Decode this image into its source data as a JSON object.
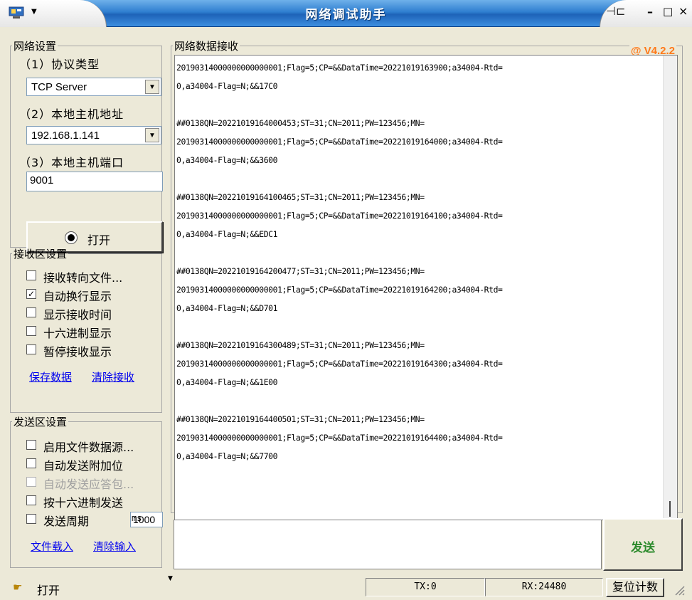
{
  "window": {
    "title": "网络调试助手",
    "version": "@ V4.2.2"
  },
  "network": {
    "group_title": "网络设置",
    "protocol_label": "（1）协议类型",
    "protocol_value": "TCP Server",
    "host_addr_label": "（2）本地主机地址",
    "host_addr_value": "192.168.1.141",
    "host_port_label": "（3）本地主机端口",
    "host_port_value": "9001",
    "open_button_label": "打开"
  },
  "receive_settings": {
    "group_title": "接收区设置",
    "options": [
      {
        "label": "接收转向文件...",
        "checked": false
      },
      {
        "label": "自动换行显示",
        "checked": true
      },
      {
        "label": "显示接收时间",
        "checked": false
      },
      {
        "label": "十六进制显示",
        "checked": false
      },
      {
        "label": "暂停接收显示",
        "checked": false
      }
    ],
    "save_link": "保存数据",
    "clear_link": "清除接收"
  },
  "send_settings": {
    "group_title": "发送区设置",
    "options": [
      {
        "label": "启用文件数据源...",
        "checked": false,
        "disabled": false
      },
      {
        "label": "自动发送附加位",
        "checked": false,
        "disabled": false
      },
      {
        "label": "自动发送应答包...",
        "checked": false,
        "disabled": true
      },
      {
        "label": "按十六进制发送",
        "checked": false,
        "disabled": false
      }
    ],
    "period_label": "发送周期",
    "period_value": "1000",
    "period_unit": "ms",
    "load_file_link": "文件载入",
    "clear_input_link": "清除输入"
  },
  "receive_area": {
    "group_title": "网络数据接收",
    "lines": [
      "20190314000000000000001;Flag=5;CP=&&DataTime=20221019163900;a34004-Rtd=",
      "0,a34004-Flag=N;&&17C0",
      "",
      "##0138QN=20221019164000453;ST=31;CN=2011;PW=123456;MN=",
      "20190314000000000000001;Flag=5;CP=&&DataTime=20221019164000;a34004-Rtd=",
      "0,a34004-Flag=N;&&3600",
      "",
      "##0138QN=20221019164100465;ST=31;CN=2011;PW=123456;MN=",
      "20190314000000000000001;Flag=5;CP=&&DataTime=20221019164100;a34004-Rtd=",
      "0,a34004-Flag=N;&&EDC1",
      "",
      "##0138QN=20221019164200477;ST=31;CN=2011;PW=123456;MN=",
      "20190314000000000000001;Flag=5;CP=&&DataTime=20221019164200;a34004-Rtd=",
      "0,a34004-Flag=N;&&D701",
      "",
      "##0138QN=20221019164300489;ST=31;CN=2011;PW=123456;MN=",
      "20190314000000000000001;Flag=5;CP=&&DataTime=20221019164300;a34004-Rtd=",
      "0,a34004-Flag=N;&&1E00",
      "",
      "##0138QN=20221019164400501;ST=31;CN=2011;PW=123456;MN=",
      "20190314000000000000001;Flag=5;CP=&&DataTime=20221019164400;a34004-Rtd=",
      "0,a34004-Flag=N;&&7700"
    ]
  },
  "send_button_label": "发送",
  "status": {
    "text": "打开",
    "tx": "TX:0",
    "rx": "RX:24480",
    "reset_label": "复位计数"
  },
  "icons": {
    "app": "app-network-icon",
    "status": "pointing-hand-icon",
    "pin": "pin-icon"
  },
  "colors": {
    "title_bar": "#2f7fd0",
    "version": "#ff7a1a",
    "send_label": "#2b8a2b",
    "link": "#0000ee"
  }
}
